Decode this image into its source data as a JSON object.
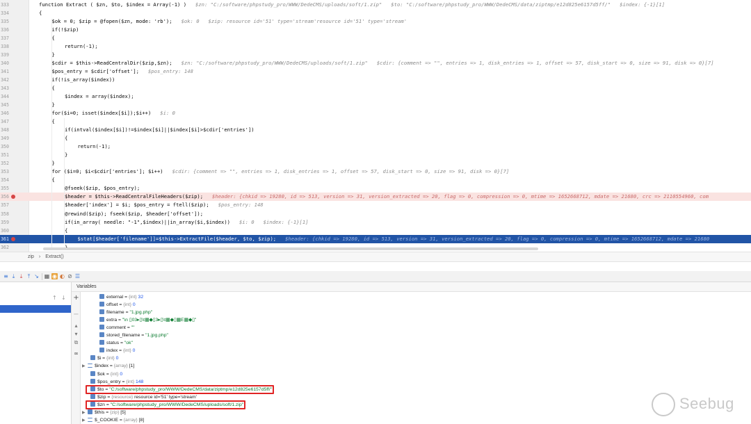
{
  "editor": {
    "lines": [
      {
        "num": "333",
        "code": "function Extract ( $zn, $to, $index = Array(-1) )",
        "hint": "$zn: \"C:/software/phpstudy_pro/WWW/DedeCMS/uploads/soft/1.zip\"   $to: \"C:/software/phpstudy_pro/WWW/DedeCMS/data/ziptmp/e12d825e6157d5ff/\"   $index: {-1}[1]",
        "indent": 0,
        "state": "normal"
      },
      {
        "num": "334",
        "code": "{",
        "hint": "",
        "indent": 0,
        "state": "normal"
      },
      {
        "num": "335",
        "code": "$ok = 0; $zip = @fopen($zn, mode: 'rb');",
        "hint": "$ok: 0   $zip: resource id='51' type='stream'resource id='51' type='stream'",
        "indent": 1,
        "state": "normal"
      },
      {
        "num": "336",
        "code": "if(!$zip)",
        "hint": "",
        "indent": 1,
        "state": "normal"
      },
      {
        "num": "337",
        "code": "{",
        "hint": "",
        "indent": 1,
        "state": "normal"
      },
      {
        "num": "338",
        "code": "return(-1);",
        "hint": "",
        "indent": 2,
        "state": "normal"
      },
      {
        "num": "339",
        "code": "}",
        "hint": "",
        "indent": 1,
        "state": "normal"
      },
      {
        "num": "340",
        "code": "$cdir = $this->ReadCentralDir($zip,$zn);",
        "hint": "$zn: \"C:/software/phpstudy_pro/WWW/DedeCMS/uploads/soft/1.zip\"   $cdir: {comment => \"\", entries => 1, disk_entries => 1, offset => 57, disk_start => 0, size => 91, disk => 0}[7]",
        "indent": 1,
        "state": "normal"
      },
      {
        "num": "341",
        "code": "$pos_entry = $cdir['offset'];",
        "hint": "$pos_entry: 148",
        "indent": 1,
        "state": "normal"
      },
      {
        "num": "342",
        "code": "if(!is_array($index))",
        "hint": "",
        "indent": 1,
        "state": "normal"
      },
      {
        "num": "343",
        "code": "{",
        "hint": "",
        "indent": 1,
        "state": "normal"
      },
      {
        "num": "344",
        "code": "$index = array($index);",
        "hint": "",
        "indent": 2,
        "state": "normal"
      },
      {
        "num": "345",
        "code": "}",
        "hint": "",
        "indent": 1,
        "state": "normal"
      },
      {
        "num": "346",
        "code": "for($i=0; isset($index[$i]);$i++)",
        "hint": "$i: 0",
        "indent": 1,
        "state": "normal"
      },
      {
        "num": "347",
        "code": "{",
        "hint": "",
        "indent": 1,
        "state": "normal"
      },
      {
        "num": "348",
        "code": "if(intval($index[$i])!=$index[$i]||$index[$i]>$cdir['entries'])",
        "hint": "",
        "indent": 2,
        "state": "normal"
      },
      {
        "num": "349",
        "code": "{",
        "hint": "",
        "indent": 2,
        "state": "normal"
      },
      {
        "num": "350",
        "code": "return(-1);",
        "hint": "",
        "indent": 3,
        "state": "normal"
      },
      {
        "num": "351",
        "code": "}",
        "hint": "",
        "indent": 2,
        "state": "normal"
      },
      {
        "num": "352",
        "code": "}",
        "hint": "",
        "indent": 1,
        "state": "normal"
      },
      {
        "num": "353",
        "code": "for ($i=0; $i<$cdir['entries']; $i++)",
        "hint": "$cdir: {comment => \"\", entries => 1, disk_entries => 1, offset => 57, disk_start => 0, size => 91, disk => 0}[7]",
        "indent": 1,
        "state": "normal"
      },
      {
        "num": "354",
        "code": "{",
        "hint": "",
        "indent": 1,
        "state": "normal"
      },
      {
        "num": "355",
        "code": "@fseek($zip, $pos_entry);",
        "hint": "",
        "indent": 2,
        "state": "normal"
      },
      {
        "num": "356",
        "code": "$header = $this->ReadCentralFileHeaders($zip);",
        "hint": "$header: {chkid => 19280, id => 513, version => 31, version_extracted => 20, flag => 0, compression => 0, mtime => 1652668712, mdate => 21680, crc => 2110554960, com",
        "indent": 2,
        "state": "breakpoint"
      },
      {
        "num": "357",
        "code": "$header['index'] = $i; $pos_entry = ftell($zip);",
        "hint": "$pos_entry: 148",
        "indent": 2,
        "state": "normal"
      },
      {
        "num": "358",
        "code": "@rewind($zip); fseek($zip, $header['offset']);",
        "hint": "",
        "indent": 2,
        "state": "normal"
      },
      {
        "num": "359",
        "code": "if(in_array( needle: \"-1\",$index)||in_array($i,$index))",
        "hint": "$i: 0   $index: {-1}[1]",
        "indent": 2,
        "state": "normal"
      },
      {
        "num": "360",
        "code": "{",
        "hint": "",
        "indent": 2,
        "state": "normal"
      },
      {
        "num": "361",
        "code": "$stat[$header['filename']]=$this->ExtractFile($header, $to, $zip);",
        "hint": "$header: {chkid => 19280, id => 513, version => 31, version_extracted => 20, flag => 0, compression => 0, mtime => 1652668712, mdate => 21680",
        "indent": 3,
        "state": "current"
      },
      {
        "num": "362",
        "code": "}",
        "hint": "",
        "indent": 2,
        "state": "normal"
      },
      {
        "num": "363",
        "code": "",
        "hint": "",
        "indent": 0,
        "state": "normal"
      }
    ]
  },
  "breadcrumb": {
    "items": [
      "zip",
      "›",
      "Extract()"
    ]
  },
  "vars_panel": {
    "title": "Variables"
  },
  "variables": [
    {
      "indent": 2,
      "expandable": false,
      "icon": "field",
      "name": "external",
      "type": "{int}",
      "value": "32",
      "vclass": "num",
      "highlight": false
    },
    {
      "indent": 2,
      "expandable": false,
      "icon": "field",
      "name": "offset",
      "type": "{int}",
      "value": "0",
      "vclass": "num",
      "highlight": false
    },
    {
      "indent": 2,
      "expandable": false,
      "icon": "field",
      "name": "filename",
      "type": "",
      "value": "\"1.jpg.php\"",
      "vclass": "str",
      "highlight": false
    },
    {
      "indent": 2,
      "expandable": false,
      "icon": "field",
      "name": "extra",
      "type": "",
      "value": "\"\\n ▯03▸▯\\t▦◆▯3▸▯\\t▦◆▯▦E▦◆▯\"",
      "vclass": "str",
      "highlight": false
    },
    {
      "indent": 2,
      "expandable": false,
      "icon": "field",
      "name": "comment",
      "type": "",
      "value": "\"\"",
      "vclass": "str",
      "highlight": false
    },
    {
      "indent": 2,
      "expandable": false,
      "icon": "field",
      "name": "stored_filename",
      "type": "",
      "value": "\"1.jpg.php\"",
      "vclass": "str",
      "highlight": false
    },
    {
      "indent": 2,
      "expandable": false,
      "icon": "field",
      "name": "status",
      "type": "",
      "value": "\"ok\"",
      "vclass": "str",
      "highlight": false
    },
    {
      "indent": 2,
      "expandable": false,
      "icon": "field",
      "name": "index",
      "type": "{int}",
      "value": "0",
      "vclass": "num",
      "highlight": false
    },
    {
      "indent": 1,
      "expandable": false,
      "icon": "field",
      "name": "$i",
      "type": "{int}",
      "value": "0",
      "vclass": "num",
      "highlight": false
    },
    {
      "indent": 0,
      "expandable": true,
      "icon": "array",
      "name": "$index",
      "type": "{array}",
      "value": "[1]",
      "vclass": "plain",
      "highlight": false
    },
    {
      "indent": 1,
      "expandable": false,
      "icon": "field",
      "name": "$ok",
      "type": "{int}",
      "value": "0",
      "vclass": "num",
      "highlight": false
    },
    {
      "indent": 1,
      "expandable": false,
      "icon": "field",
      "name": "$pos_entry",
      "type": "{int}",
      "value": "148",
      "vclass": "num",
      "highlight": false
    },
    {
      "indent": 1,
      "expandable": false,
      "icon": "field",
      "name": "$to",
      "type": "",
      "value": "\"C:/software/phpstudy_pro/WWW/DedeCMS/data/ziptmp/e12d825e6157d5ff/\"",
      "vclass": "str",
      "highlight": true
    },
    {
      "indent": 1,
      "expandable": false,
      "icon": "field",
      "name": "$zip",
      "type": "{resource}",
      "value": "resource id='51' type='stream'",
      "vclass": "plain",
      "highlight": false
    },
    {
      "indent": 1,
      "expandable": false,
      "icon": "field",
      "name": "$zn",
      "type": "",
      "value": "\"C:/software/phpstudy_pro/WWW/DedeCMS/uploads/soft/1.zip\"",
      "vclass": "str",
      "highlight": true
    },
    {
      "indent": 0,
      "expandable": true,
      "icon": "field",
      "name": "$this",
      "type": "{zip}",
      "value": "[5]",
      "vclass": "plain",
      "highlight": false
    },
    {
      "indent": 0,
      "expandable": true,
      "icon": "array",
      "name": "$_COOKIE",
      "type": "{array}",
      "value": "[8]",
      "vclass": "plain",
      "highlight": false
    }
  ],
  "watermark": {
    "text": "Seebug"
  },
  "colors": {
    "current_line": "#2154a6",
    "breakpoint_line": "#fae3e1",
    "highlight_box": "#e02424",
    "string": "#0a7a2e",
    "number": "#1750eb"
  },
  "icons": {
    "toolbar": [
      "step-over-icon",
      "step-into-icon",
      "force-step-into-icon",
      "step-out-icon",
      "run-to-cursor-icon",
      "evaluate-icon",
      "frames-view-icon",
      "watch-icon",
      "mute-breakpoints-icon",
      "settings-icon"
    ],
    "vars_side": [
      "add-watch-icon",
      "remove-watch-icon",
      "up-icon",
      "down-icon",
      "copy-icon",
      "glasses-icon"
    ]
  }
}
